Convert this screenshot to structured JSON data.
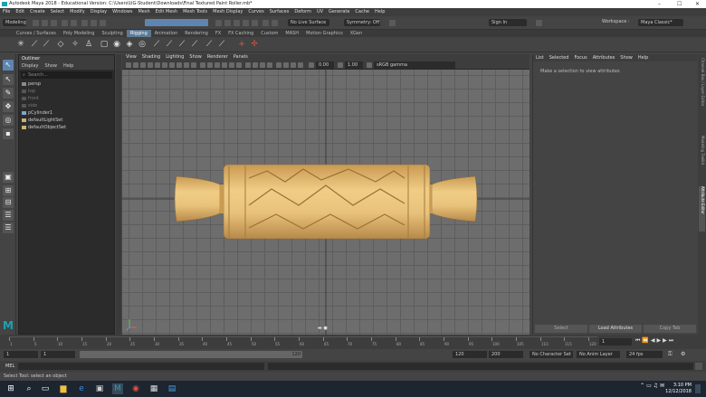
{
  "window": {
    "title": "Autodesk Maya 2018 - Educational Version: C:\\Users\\UG-Student\\Downloads\\Final Textured Paint Roller.mb*",
    "workspace_label": "Workspace :",
    "workspace_value": "Maya Classic*"
  },
  "menubar": [
    "File",
    "Edit",
    "Create",
    "Select",
    "Modify",
    "Display",
    "Windows",
    "Mesh",
    "Edit Mesh",
    "Mesh Tools",
    "Mesh Display",
    "Curves",
    "Surfaces",
    "Deform",
    "UV",
    "Generate",
    "Cache",
    "Help"
  ],
  "status_line": {
    "mode": "Modeling",
    "live_surface": "No Live Surface",
    "symmetry": "Symmetry: Off",
    "sign_in": "Sign In"
  },
  "shelf_tabs": [
    "Curves / Surfaces",
    "Poly Modeling",
    "Sculpting",
    "Rigging",
    "Animation",
    "Rendering",
    "FX",
    "FX Caching",
    "Custom",
    "MASH",
    "Motion Graphics",
    "XGen"
  ],
  "active_shelf_tab": "Rigging",
  "outliner": {
    "title": "Outliner",
    "menu": [
      "Display",
      "Show",
      "Help"
    ],
    "search_placeholder": "Search...",
    "items": [
      {
        "label": "persp",
        "dim": false
      },
      {
        "label": "top",
        "dim": true
      },
      {
        "label": "front",
        "dim": true
      },
      {
        "label": "side",
        "dim": true
      },
      {
        "label": "pCylinder1",
        "dim": false
      },
      {
        "label": "defaultLightSet",
        "dim": false
      },
      {
        "label": "defaultObjectSet",
        "dim": false
      }
    ]
  },
  "viewport": {
    "menu": [
      "View",
      "Shading",
      "Lighting",
      "Show",
      "Renderer",
      "Panels"
    ],
    "field_a": "0.00",
    "field_b": "1.00",
    "color_space": "sRGB gamma"
  },
  "attribute_editor": {
    "menu": [
      "List",
      "Selected",
      "Focus",
      "Attributes",
      "Show",
      "Help"
    ],
    "message": "Make a selection to view attributes",
    "buttons": [
      "Select",
      "Load Attributes",
      "Copy Tab"
    ]
  },
  "right_tabs": [
    "Channel Box / Layer Editor",
    "Modeling Toolkit",
    "Attribute Editor"
  ],
  "time_slider": {
    "ticks": [
      "1",
      "5",
      "10",
      "15",
      "20",
      "25",
      "30",
      "35",
      "40",
      "45",
      "50",
      "55",
      "60",
      "65",
      "70",
      "75",
      "80",
      "85",
      "90",
      "95",
      "100",
      "105",
      "110",
      "115",
      "120"
    ],
    "current_frame": "1"
  },
  "range_slider": {
    "start": "1",
    "start_inner": "1",
    "range_end": "120",
    "end_inner": "120",
    "end": "200",
    "character_set": "No Character Set",
    "anim_layer": "No Anim Layer",
    "fps": "24 fps"
  },
  "command_line": {
    "label": "MEL"
  },
  "help_line": "Select Tool: select an object",
  "taskbar": {
    "time": "3:10 PM",
    "date": "12/12/2018"
  },
  "colors": {
    "wood": "#e8c27a",
    "viewport_bg": "#6d6d6d",
    "active_tab": "#5d7a95",
    "maya_logo": "#1aa3b3"
  }
}
